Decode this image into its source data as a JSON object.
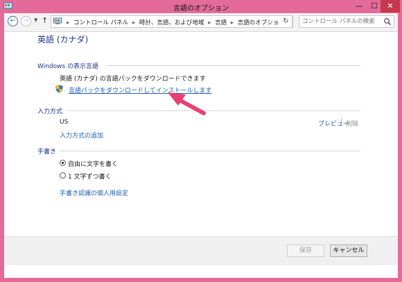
{
  "window": {
    "title": "言語のオプション",
    "minimize_glyph": "—",
    "maximize_glyph": "☐",
    "close_glyph": "✕"
  },
  "nav": {
    "back_glyph": "←",
    "forward_glyph": "→",
    "dropdown_glyph": "▼",
    "up_glyph": "↑",
    "breadcrumbs": [
      "コントロール パネル",
      "時計、言語、および地域",
      "言語",
      "言語のオプション"
    ],
    "separator": "▸",
    "refresh_glyph": "↻",
    "search_placeholder": "コントロール パネルの検索"
  },
  "main": {
    "language_title": "英語 (カナダ)",
    "display_language": {
      "label": "Windows の表示言語",
      "info_text": "英語 (カナダ) の言語パックをダウンロードできます",
      "download_link": "言語パックをダウンロードしてインストールします"
    },
    "input_method": {
      "label": "入力方式",
      "current": "US",
      "preview_link": "プレビュー",
      "separator": "|",
      "remove_link": "削除",
      "add_link": "入力方式の追加"
    },
    "handwriting": {
      "label": "手書き",
      "option_freehand": "自由に文字を書く",
      "option_single": "1 文字ずつ書く",
      "selected": "自由に文字を書く",
      "personalize_link": "手書き認識の個人用設定"
    }
  },
  "footer": {
    "save_label": "保存",
    "cancel_label": "キャンセル"
  },
  "colors": {
    "desktop": "#e46b99",
    "heading": "#1e3287",
    "link": "#1a5fb4",
    "close_button": "#c7384c",
    "annotation_arrow": "#ea3f73"
  },
  "icons": {
    "app": "control-panel-icon",
    "address": "control-panel-icon",
    "search": "search-icon",
    "shield": "uac-shield-icon"
  }
}
